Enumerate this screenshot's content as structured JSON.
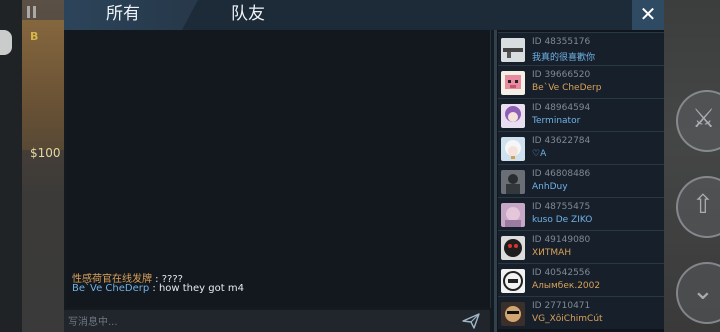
{
  "tabs": {
    "all": "所有",
    "team": "队友"
  },
  "close_label": "✕",
  "background": {
    "money": "$100",
    "b_letter": "B"
  },
  "chat": {
    "messages": [
      {
        "name": "性感荷官在线发牌",
        "sep": " : ",
        "text": "????",
        "name_color": "orange"
      },
      {
        "name": "Be`Ve CheDerp",
        "sep": " : ",
        "text": "how they got m4",
        "name_color": "blue"
      }
    ],
    "placeholder": "写消息中..."
  },
  "players": [
    {
      "id": "ID 48355176",
      "name": "我真的很喜歡你",
      "name_color": "blue",
      "avatar": "avatar-gun"
    },
    {
      "id": "ID 39666520",
      "name": "Be`Ve CheDerp",
      "name_color": "orange",
      "avatar": "avatar-pig"
    },
    {
      "id": "ID 48964594",
      "name": "Terminator",
      "name_color": "blue",
      "avatar": "avatar-anime-purple"
    },
    {
      "id": "ID 43622784",
      "name": "♡A",
      "name_color": "blue",
      "avatar": "avatar-anime-white"
    },
    {
      "id": "ID 46808486",
      "name": "AnhDuy",
      "name_color": "blue",
      "avatar": "avatar-dark-figure"
    },
    {
      "id": "ID 48755475",
      "name": "kuso De ZIKO",
      "name_color": "blue",
      "avatar": "avatar-pink"
    },
    {
      "id": "ID 49149080",
      "name": "ХИТМАН",
      "name_color": "orange",
      "avatar": "avatar-monster"
    },
    {
      "id": "ID 40542556",
      "name": "Алымбек.2002",
      "name_color": "orange",
      "avatar": "avatar-kgz-logo"
    },
    {
      "id": "ID 27710471",
      "name": "VG_XôiChimCút",
      "name_color": "orange",
      "avatar": "avatar-face"
    }
  ]
}
